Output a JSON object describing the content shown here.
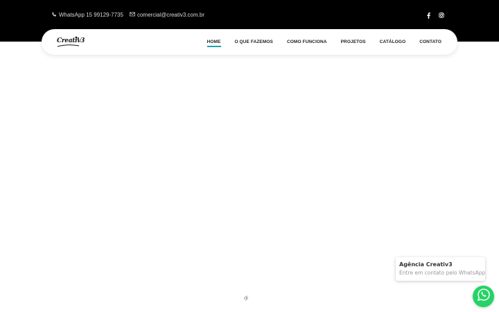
{
  "topbar": {
    "whatsapp_text": "WhatsApp 15 99129-7735",
    "email_text": "comercial@creativ3.com.br",
    "icons": [
      "phone-icon",
      "envelope-icon",
      "facebook-icon",
      "instagram-icon"
    ]
  },
  "brand": {
    "logo_text": "Creativ3"
  },
  "nav": {
    "items": [
      {
        "label": "HOME",
        "active": true
      },
      {
        "label": "O QUE FAZEMOS"
      },
      {
        "label": "COMO FUNCIONA"
      },
      {
        "label": "PROJETOS"
      },
      {
        "label": "CATÁLOGO"
      },
      {
        "label": "CONTATO"
      }
    ]
  },
  "loader": {
    "glyph": "ɾʃɾ"
  },
  "whatsapp_widget": {
    "title": "Agência Creativ3",
    "subtitle": "Entre em contato pelo WhatsApp"
  },
  "colors": {
    "topbar_bg": "#000000",
    "accent": "#1aa3a8",
    "whatsapp_green": "#25d366"
  }
}
